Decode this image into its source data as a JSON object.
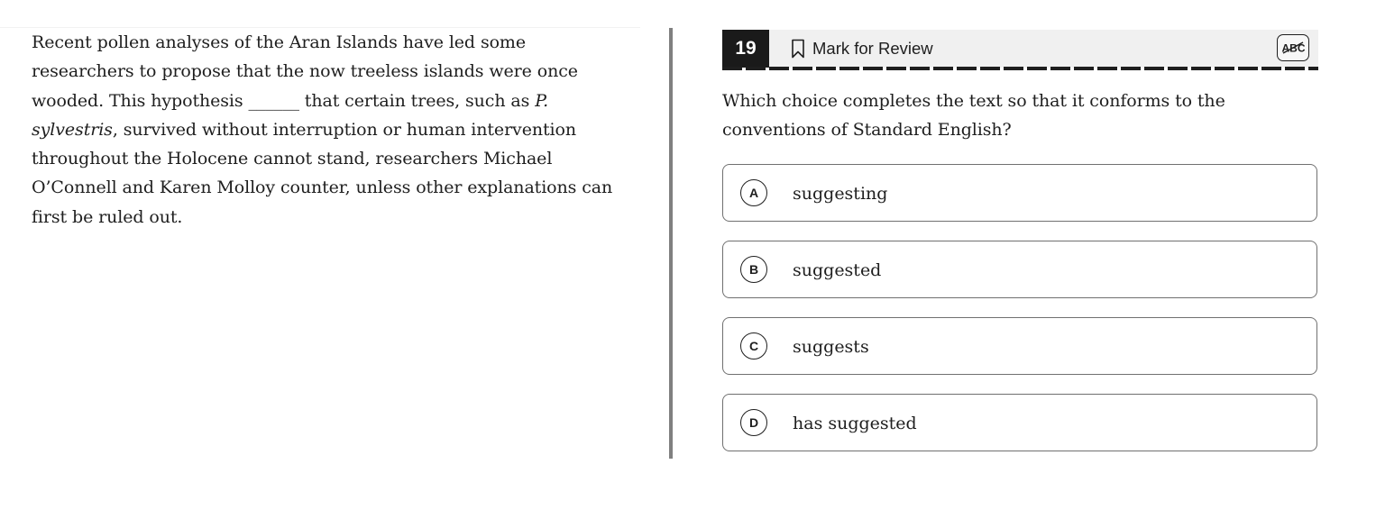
{
  "passage": {
    "part1": "Recent pollen analyses of the Aran Islands have led some researchers to propose that the now treeless islands were once wooded. This hypothesis ______ that certain trees, such as ",
    "italic1": "P. sylvestris",
    "part2": ", survived without interruption or human intervention throughout the Holocene cannot stand, researchers Michael O’Connell and Karen Molloy counter, unless other explanations can first be ruled out."
  },
  "question": {
    "number": "19",
    "mark_for_review_label": "Mark for Review",
    "eliminator_icon": "abc-strikethrough-icon",
    "prompt": "Which choice completes the text so that it conforms to the conventions of Standard English?"
  },
  "choices": [
    {
      "letter": "A",
      "text": "suggesting"
    },
    {
      "letter": "B",
      "text": "suggested"
    },
    {
      "letter": "C",
      "text": "suggests"
    },
    {
      "letter": "D",
      "text": "has suggested"
    }
  ],
  "colors": {
    "text": "#1e1e1e",
    "header_bg": "#f0f0f0",
    "number_bg": "#1a1a1a",
    "divider": "#808080",
    "choice_border": "#707070"
  }
}
